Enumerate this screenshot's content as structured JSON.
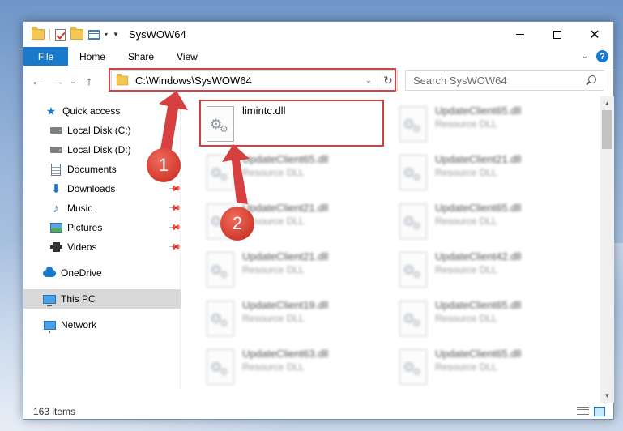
{
  "window": {
    "title": "SysWOW64",
    "controls": {
      "minimize": "—",
      "maximize": "☐",
      "close": "✕"
    }
  },
  "ribbon": {
    "tabs": [
      "File",
      "Home",
      "Share",
      "View"
    ],
    "help": "?"
  },
  "navigation": {
    "address": "C:\\Windows\\SysWOW64",
    "search_placeholder": "Search SysWOW64"
  },
  "sidebar": {
    "items": [
      {
        "label": "Quick access",
        "icon": "star-icon"
      },
      {
        "label": "Local Disk (C:)",
        "icon": "drive-icon"
      },
      {
        "label": "Local Disk (D:)",
        "icon": "drive-icon"
      },
      {
        "label": "Documents",
        "icon": "documents-icon",
        "pinned": true
      },
      {
        "label": "Downloads",
        "icon": "downloads-icon",
        "pinned": true
      },
      {
        "label": "Music",
        "icon": "music-icon",
        "pinned": true
      },
      {
        "label": "Pictures",
        "icon": "pictures-icon",
        "pinned": true
      },
      {
        "label": "Videos",
        "icon": "videos-icon",
        "pinned": true
      },
      {
        "label": "OneDrive",
        "icon": "onedrive-icon"
      },
      {
        "label": "This PC",
        "icon": "this-pc-icon",
        "selected": true
      },
      {
        "label": "Network",
        "icon": "network-icon"
      }
    ]
  },
  "files": [
    {
      "name": "limintc.dll",
      "type": ""
    },
    {
      "name": "UpdateClient65.dll",
      "type": "Resource DLL"
    },
    {
      "name": "UpdateClient65.dll",
      "type": "Resource DLL"
    },
    {
      "name": "UpdateClient21.dll",
      "type": "Resource DLL"
    },
    {
      "name": "UpdateClient21.dll",
      "type": "Resource DLL"
    },
    {
      "name": "UpdateClient65.dll",
      "type": "Resource DLL"
    },
    {
      "name": "UpdateClient21.dll",
      "type": "Resource DLL"
    },
    {
      "name": "UpdateClient42.dll",
      "type": "Resource DLL"
    },
    {
      "name": "UpdateClient19.dll",
      "type": "Resource DLL"
    },
    {
      "name": "UpdateClient65.dll",
      "type": "Resource DLL"
    },
    {
      "name": "UpdateClient63.dll",
      "type": "Resource DLL"
    },
    {
      "name": "UpdateClient65.dll",
      "type": "Resource DLL"
    }
  ],
  "status": {
    "item_count": "163 items"
  },
  "annotations": {
    "step1": "1",
    "step2": "2",
    "color": "#d64040"
  }
}
